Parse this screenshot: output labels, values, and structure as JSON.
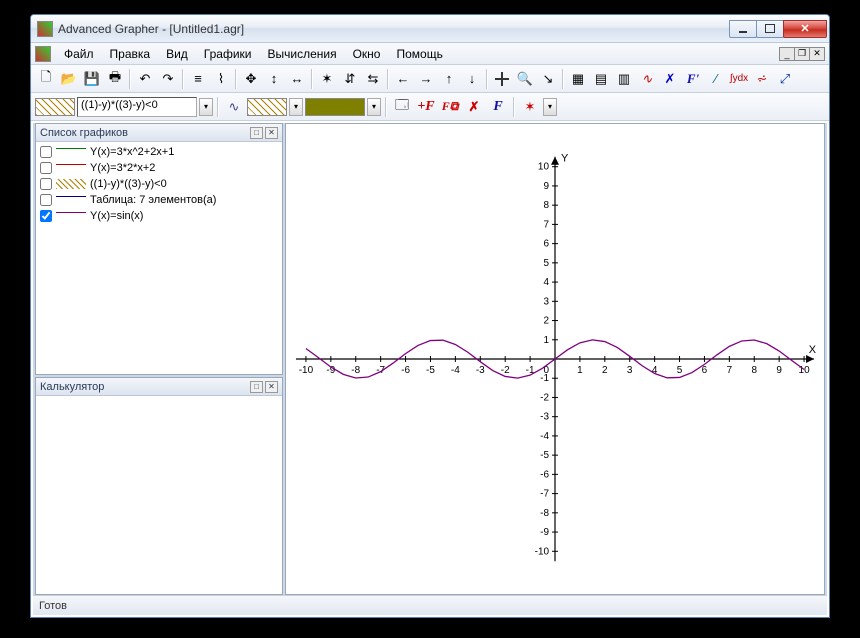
{
  "window": {
    "title": "Advanced Grapher - [Untitled1.agr]"
  },
  "menu": {
    "file": "Файл",
    "edit": "Правка",
    "view": "Вид",
    "graphs": "Графики",
    "calc": "Вычисления",
    "window": "Окно",
    "help": "Помощь"
  },
  "toolbar2": {
    "formula": "((1)-y)*((3)-y)<0"
  },
  "panels": {
    "graphlist_title": "Список графиков",
    "calc_title": "Калькулятор"
  },
  "graphs": [
    {
      "checked": false,
      "style": "line-green",
      "label": "Y(x)=3*x^2+2x+1"
    },
    {
      "checked": false,
      "style": "line-red",
      "label": "Y(x)=3*2*x+2"
    },
    {
      "checked": false,
      "style": "hatchsw",
      "label": "((1)-y)*((3)-y)<0"
    },
    {
      "checked": false,
      "style": "line-blue",
      "label": "Таблица: 7 элементов(а)"
    },
    {
      "checked": true,
      "style": "line-purple",
      "label": "Y(x)=sin(x)"
    }
  ],
  "status": {
    "text": "Готов"
  },
  "chart_data": {
    "type": "line",
    "title": "",
    "xlabel": "X",
    "ylabel": "Y",
    "xlim": [
      -10,
      10
    ],
    "ylim": [
      -10,
      10
    ],
    "x_ticks": [
      -10,
      -9,
      -8,
      -7,
      -6,
      -5,
      -4,
      -3,
      -2,
      -1,
      0,
      1,
      2,
      3,
      4,
      5,
      6,
      7,
      8,
      9,
      10
    ],
    "y_ticks": [
      -10,
      -9,
      -8,
      -7,
      -6,
      -5,
      -4,
      -3,
      -2,
      -1,
      0,
      1,
      2,
      3,
      4,
      5,
      6,
      7,
      8,
      9,
      10
    ],
    "series": [
      {
        "name": "Y(x)=sin(x)",
        "color": "#800080",
        "function": "sin(x)",
        "x": [
          -10,
          -9.5,
          -9,
          -8.5,
          -8,
          -7.5,
          -7,
          -6.5,
          -6,
          -5.5,
          -5,
          -4.5,
          -4,
          -3.5,
          -3,
          -2.5,
          -2,
          -1.5,
          -1,
          -0.5,
          0,
          0.5,
          1,
          1.5,
          2,
          2.5,
          3,
          3.5,
          4,
          4.5,
          5,
          5.5,
          6,
          6.5,
          7,
          7.5,
          8,
          8.5,
          9,
          9.5,
          10
        ],
        "y": [
          0.544,
          0.075,
          -0.412,
          -0.798,
          -0.989,
          -0.938,
          -0.657,
          -0.215,
          0.279,
          0.706,
          0.959,
          0.978,
          0.757,
          0.351,
          -0.141,
          -0.599,
          -0.909,
          -0.997,
          -0.841,
          -0.479,
          0.0,
          0.479,
          0.841,
          0.997,
          0.909,
          0.599,
          0.141,
          -0.351,
          -0.757,
          -0.978,
          -0.959,
          -0.706,
          -0.279,
          0.215,
          0.657,
          0.938,
          0.989,
          0.798,
          0.412,
          -0.075,
          -0.544
        ]
      }
    ]
  }
}
